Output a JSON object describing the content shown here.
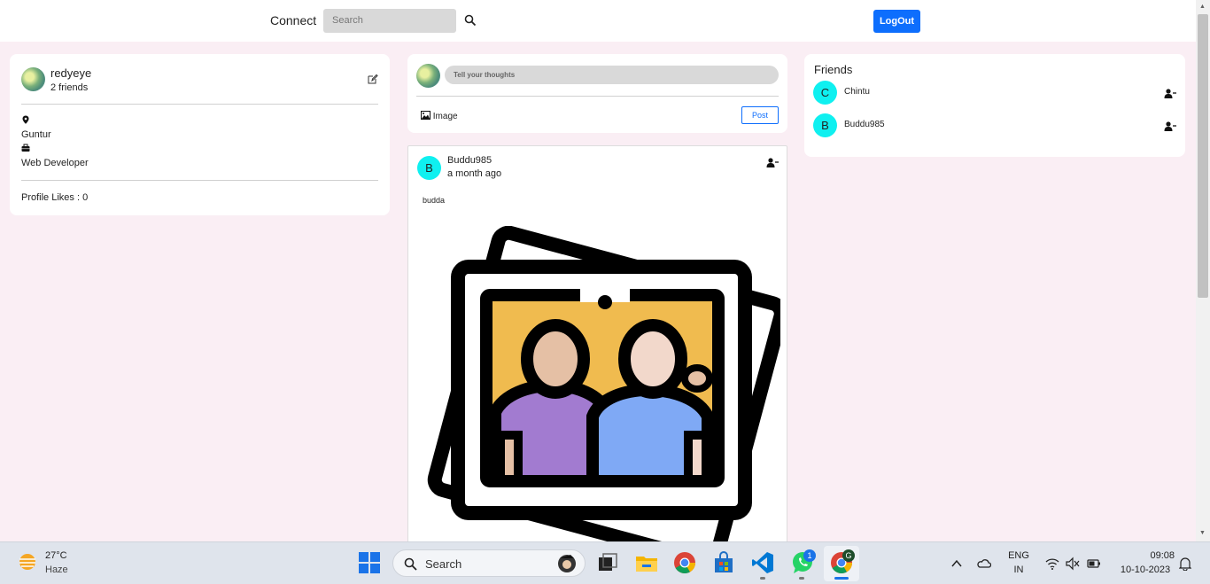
{
  "header": {
    "brand": "Connect",
    "search_placeholder": "Search",
    "logout_label": "LogOut"
  },
  "colors": {
    "accent": "#0d6efd",
    "page_background": "#faeef4",
    "avatar_letter_bg": "#0ff0f0"
  },
  "profile": {
    "name": "redyeye",
    "friends_count": "2 friends",
    "location": "Guntur",
    "occupation": "Web Developer",
    "likes": "Profile Likes : 0"
  },
  "compose": {
    "placeholder": "Tell your thoughts",
    "image_label": "Image",
    "post_label": "Post"
  },
  "post": {
    "avatar_letter": "B",
    "author": "Buddu985",
    "time": "a month ago",
    "description": "budda"
  },
  "friends": {
    "title": "Friends",
    "items": [
      {
        "letter": "C",
        "name": "Chintu"
      },
      {
        "letter": "B",
        "name": "Buddu985"
      }
    ]
  },
  "taskbar": {
    "weather_temp": "27°C",
    "weather_desc": "Haze",
    "search_label": "Search",
    "whatsapp_badge": "1",
    "chrome_profile_badge": "G",
    "language_top": "ENG",
    "language_bottom": "IN",
    "time": "09:08",
    "date": "10-10-2023",
    "icons": [
      "windows-start-icon",
      "task-view-icon",
      "file-explorer-icon",
      "chrome-icon",
      "microsoft-store-icon",
      "vscode-icon",
      "whatsapp-icon",
      "chrome-profile-icon"
    ]
  }
}
